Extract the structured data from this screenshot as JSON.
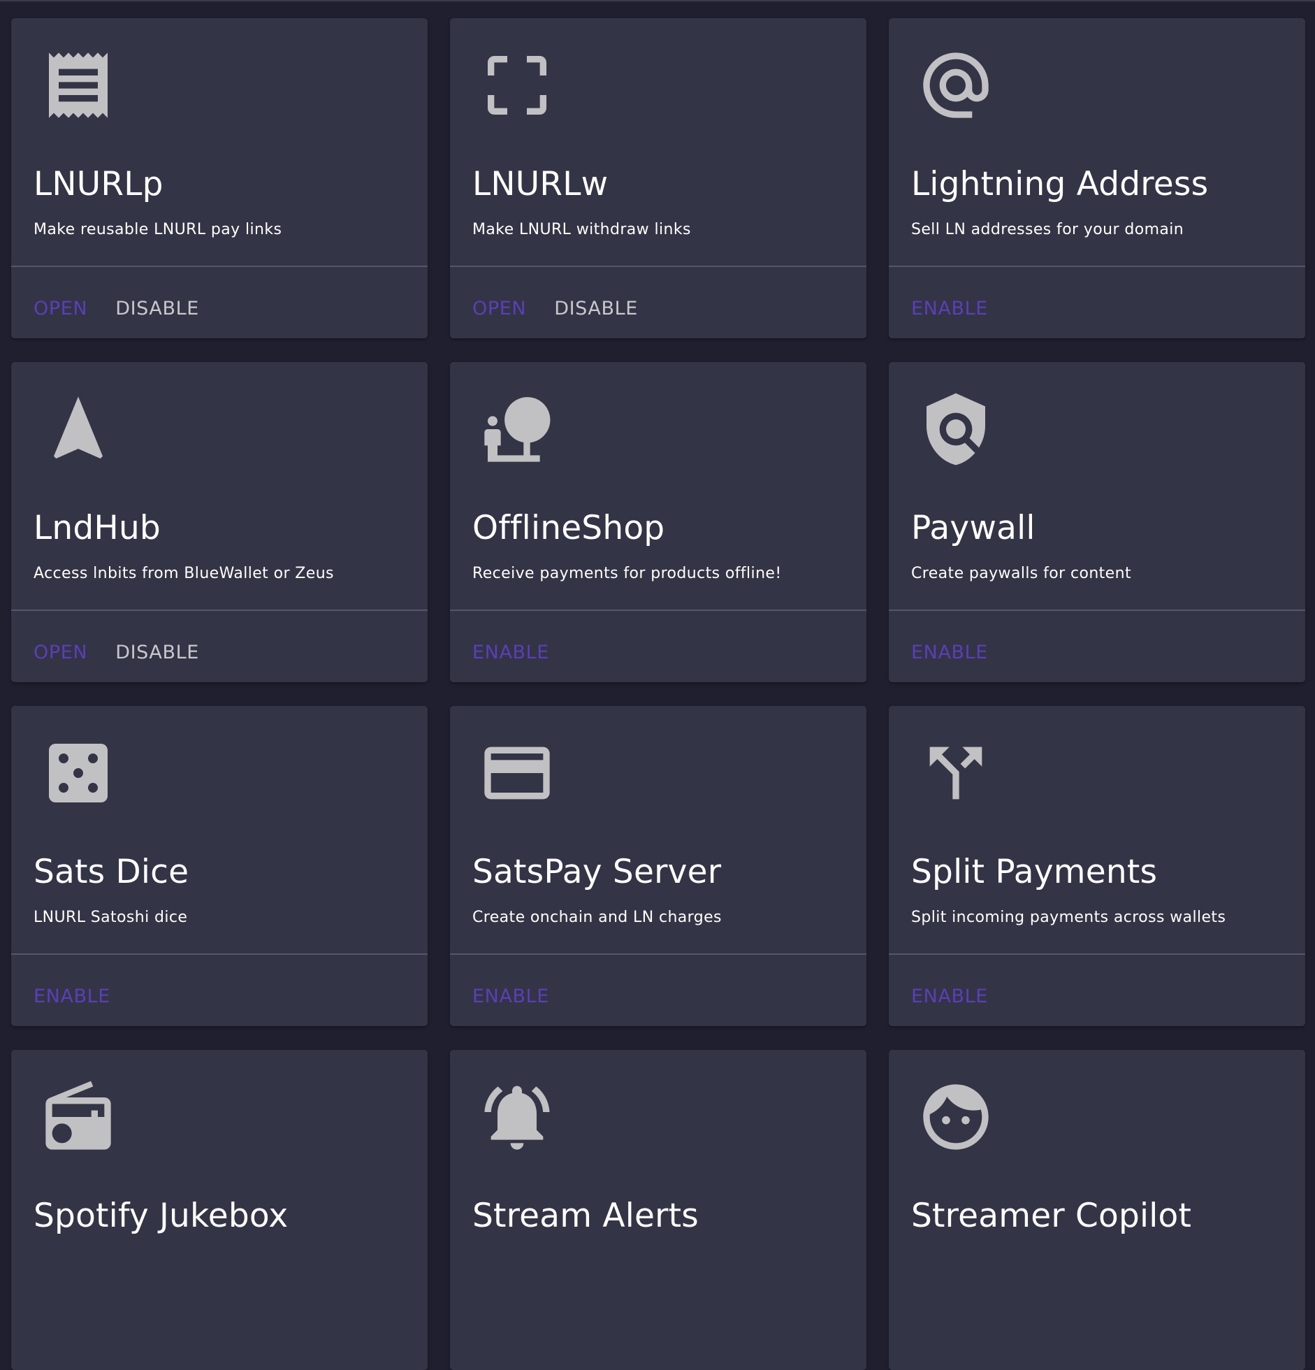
{
  "colors": {
    "background": "#1f1f30",
    "card": "#333446",
    "icon": "#c1c1c3",
    "accent": "#5a3fb7",
    "secondary_action": "#c8c8cc"
  },
  "extensions": [
    {
      "title": "LNURLp",
      "description": "Make reusable LNURL pay links",
      "icon": "receipt-icon",
      "actions": [
        {
          "label": "OPEN",
          "kind": "primary"
        },
        {
          "label": "DISABLE",
          "kind": "secondary"
        }
      ]
    },
    {
      "title": "LNURLw",
      "description": "Make LNURL withdraw links",
      "icon": "crop-free-icon",
      "actions": [
        {
          "label": "OPEN",
          "kind": "primary"
        },
        {
          "label": "DISABLE",
          "kind": "secondary"
        }
      ]
    },
    {
      "title": "Lightning Address",
      "description": "Sell LN addresses for your domain",
      "icon": "alternate-email-icon",
      "actions": [
        {
          "label": "ENABLE",
          "kind": "primary"
        }
      ]
    },
    {
      "title": "LndHub",
      "description": "Access lnbits from BlueWallet or Zeus",
      "icon": "navigation-icon",
      "actions": [
        {
          "label": "OPEN",
          "kind": "primary"
        },
        {
          "label": "DISABLE",
          "kind": "secondary"
        }
      ]
    },
    {
      "title": "OfflineShop",
      "description": "Receive payments for products offline!",
      "icon": "nature-people-icon",
      "actions": [
        {
          "label": "ENABLE",
          "kind": "primary"
        }
      ]
    },
    {
      "title": "Paywall",
      "description": "Create paywalls for content",
      "icon": "policy-icon",
      "actions": [
        {
          "label": "ENABLE",
          "kind": "primary"
        }
      ]
    },
    {
      "title": "Sats Dice",
      "description": "LNURL Satoshi dice",
      "icon": "casino-icon",
      "actions": [
        {
          "label": "ENABLE",
          "kind": "primary"
        }
      ]
    },
    {
      "title": "SatsPay Server",
      "description": "Create onchain and LN charges",
      "icon": "credit-card-icon",
      "actions": [
        {
          "label": "ENABLE",
          "kind": "primary"
        }
      ]
    },
    {
      "title": "Split Payments",
      "description": "Split incoming payments across wallets",
      "icon": "call-split-icon",
      "actions": [
        {
          "label": "ENABLE",
          "kind": "primary"
        }
      ]
    },
    {
      "title": "Spotify Jukebox",
      "description": "",
      "icon": "radio-icon",
      "actions": []
    },
    {
      "title": "Stream Alerts",
      "description": "",
      "icon": "notifications-active-icon",
      "actions": []
    },
    {
      "title": "Streamer Copilot",
      "description": "",
      "icon": "face-icon",
      "actions": []
    }
  ]
}
